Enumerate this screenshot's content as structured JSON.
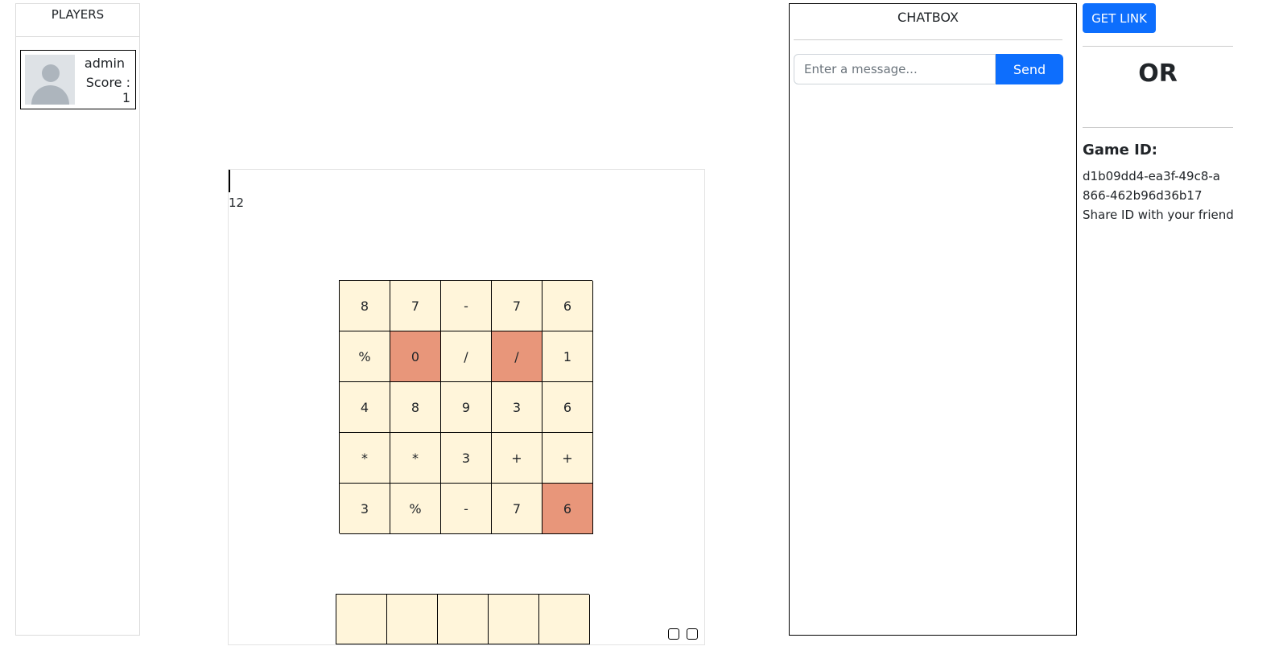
{
  "players_panel": {
    "title": "PLAYERS",
    "players": [
      {
        "name": "admin",
        "score_text": "Score : 1"
      }
    ]
  },
  "game": {
    "target": "12",
    "grid": [
      [
        {
          "v": "8",
          "sel": false
        },
        {
          "v": "7",
          "sel": false
        },
        {
          "v": "-",
          "sel": false
        },
        {
          "v": "7",
          "sel": false
        },
        {
          "v": "6",
          "sel": false
        }
      ],
      [
        {
          "v": "%",
          "sel": false
        },
        {
          "v": "0",
          "sel": true
        },
        {
          "v": "/",
          "sel": false
        },
        {
          "v": "/",
          "sel": true
        },
        {
          "v": "1",
          "sel": false
        }
      ],
      [
        {
          "v": "4",
          "sel": false
        },
        {
          "v": "8",
          "sel": false
        },
        {
          "v": "9",
          "sel": false
        },
        {
          "v": "3",
          "sel": false
        },
        {
          "v": "6",
          "sel": false
        }
      ],
      [
        {
          "v": "*",
          "sel": false
        },
        {
          "v": "*",
          "sel": false
        },
        {
          "v": "3",
          "sel": false
        },
        {
          "v": "+",
          "sel": false
        },
        {
          "v": "+",
          "sel": false
        }
      ],
      [
        {
          "v": "3",
          "sel": false
        },
        {
          "v": "%",
          "sel": false
        },
        {
          "v": "-",
          "sel": false
        },
        {
          "v": "7",
          "sel": false
        },
        {
          "v": "6",
          "sel": true
        }
      ]
    ],
    "slots": [
      "",
      "",
      "",
      "",
      ""
    ],
    "colors": {
      "cell": "#fff5da",
      "selected": "#e8967a"
    }
  },
  "chat": {
    "title": "CHATBOX",
    "input_placeholder": "Enter a message...",
    "send_label": "Send"
  },
  "share": {
    "get_link_label": "GET LINK",
    "or_text": "OR",
    "game_id_title": "Game ID:",
    "game_id": "d1b09dd4-ea3f-49c8-a866-462b96d36b17",
    "share_hint": "Share ID with your friend",
    "accent": "#0d6efd"
  }
}
